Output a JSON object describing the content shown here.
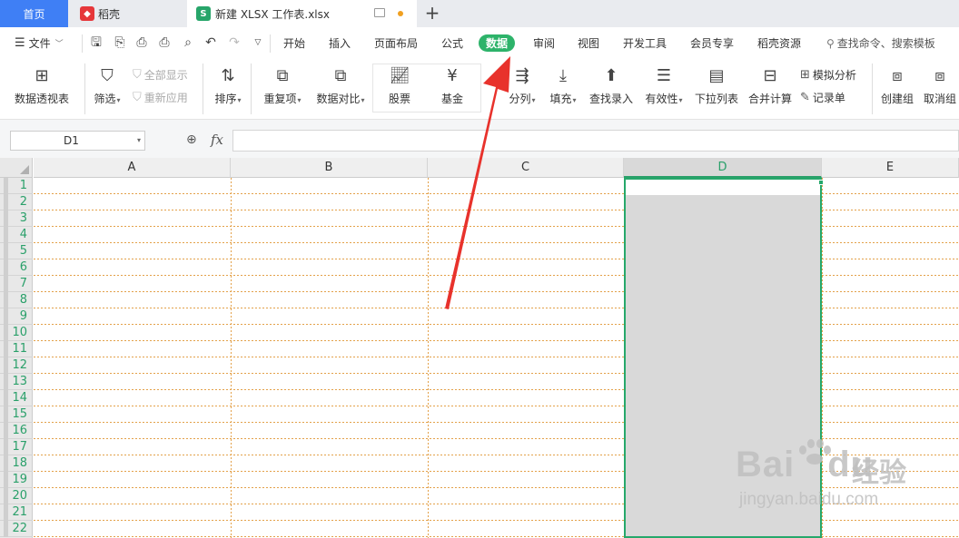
{
  "tabs": {
    "home": "首页",
    "daoke": "稻壳",
    "file": "新建 XLSX 工作表.xlsx",
    "new_tab": "+"
  },
  "menu": {
    "file_label": "文件",
    "tabs": [
      "开始",
      "插入",
      "页面布局",
      "公式",
      "数据",
      "审阅",
      "视图",
      "开发工具",
      "会员专享",
      "稻壳资源"
    ],
    "active_tab": "数据",
    "search_label": "查找命令、搜索模板"
  },
  "ribbon": {
    "pivot": "数据透视表",
    "filter": "筛选",
    "show_all": "全部显示",
    "reapply": "重新应用",
    "sort": "排序",
    "duplicates": "重复项",
    "compare": "数据对比",
    "stock": "股票",
    "fund": "基金",
    "split": "分列",
    "fill": "填充",
    "lookup_entry": "查找录入",
    "validity": "有效性",
    "dropdown_list": "下拉列表",
    "consolidate": "合并计算",
    "simulation": "模拟分析",
    "record_form": "记录单",
    "group": "创建组",
    "ungroup": "取消组"
  },
  "formula_bar": {
    "name_box": "D1",
    "fx": "fx",
    "value": ""
  },
  "sheet": {
    "columns": [
      "A",
      "B",
      "C",
      "D",
      "E"
    ],
    "selected_column": "D",
    "rows": [
      "1",
      "2",
      "3",
      "4",
      "5",
      "6",
      "7",
      "8",
      "9",
      "10",
      "11",
      "12",
      "13",
      "14",
      "15",
      "16",
      "17",
      "18",
      "19",
      "20",
      "21",
      "22"
    ]
  },
  "watermark": {
    "brand": "Bai",
    "brand2": "du",
    "cn": "经验",
    "url": "jingyan.baidu.com"
  },
  "colors": {
    "accent_green": "#2db36a",
    "home_tab_blue": "#3f7ff5",
    "arrow_red": "#e8322c",
    "grid_orange": "#e3a14a"
  }
}
